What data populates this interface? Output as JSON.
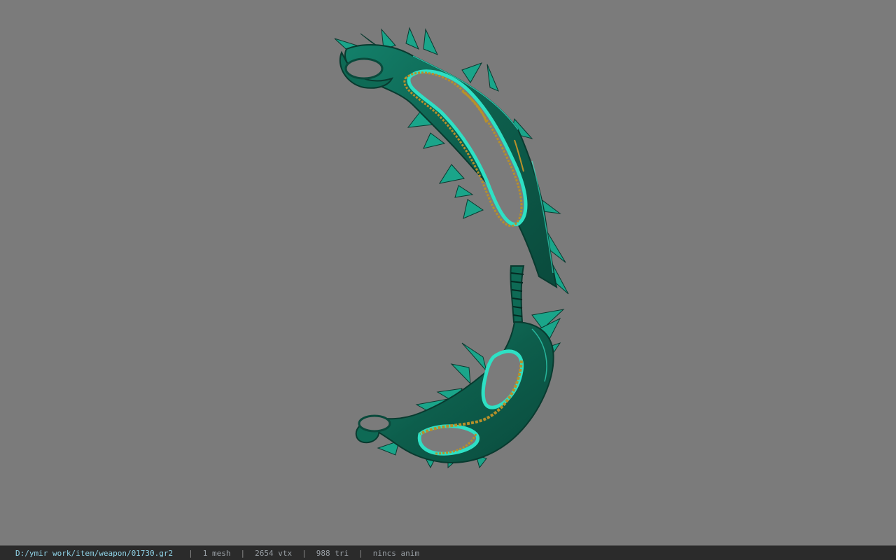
{
  "viewer": {
    "background_color": "#7b7b7b",
    "model_colors": {
      "body": "#0f6a55",
      "edge": "#2ee0c4",
      "gold": "#b8902a",
      "dark": "#0a3a30"
    }
  },
  "statusbar": {
    "file_path": "D:/ymir work/item/weapon/01730.gr2",
    "separator": "|",
    "mesh_count": "1 mesh",
    "vertex_count": "2654 vtx",
    "triangle_count": "988 tri",
    "anim_status": "nincs anim"
  }
}
